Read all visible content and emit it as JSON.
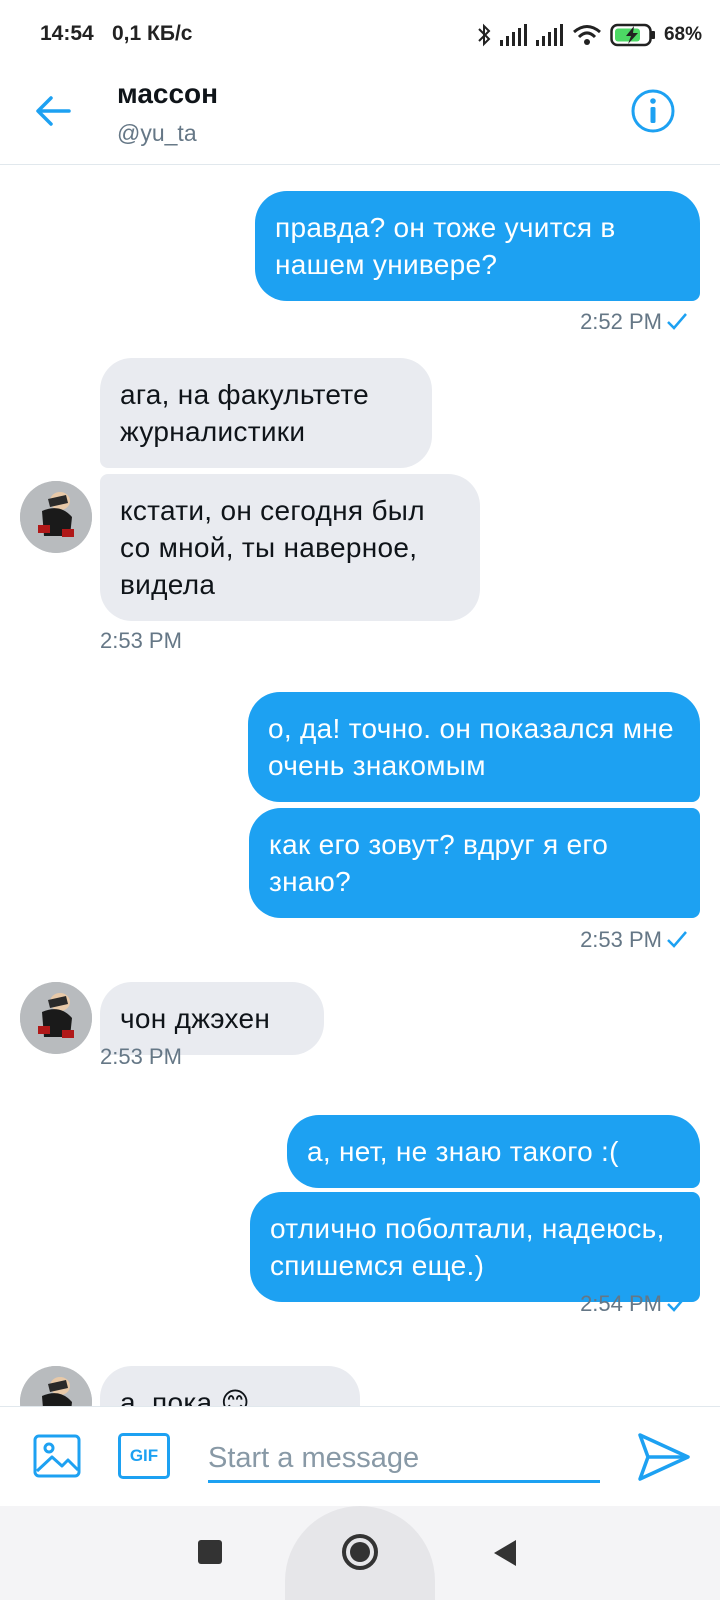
{
  "status_bar": {
    "time": "14:54",
    "network_speed": "0,1 КБ/с",
    "battery": "68%",
    "icons": [
      "bluetooth-icon",
      "signal-icon",
      "signal-icon",
      "wifi-icon",
      "battery-charging-icon"
    ]
  },
  "header": {
    "name": "массон",
    "handle": "@yu_ta",
    "icons": [
      "back-arrow-icon",
      "info-icon"
    ]
  },
  "messages": [
    {
      "direction": "out",
      "text": "правда? он тоже учится в нашем универе?"
    },
    {
      "direction": "out",
      "timestamp": "2:52 PM",
      "read": true
    },
    {
      "direction": "in",
      "text": "ага, на факультете журналистики"
    },
    {
      "direction": "in",
      "text": "кстати, он сегодня был со мной, ты наверное, видела"
    },
    {
      "direction": "in",
      "timestamp": "2:53 PM"
    },
    {
      "direction": "out",
      "text": "о, да! точно. он показался мне очень знакомым"
    },
    {
      "direction": "out",
      "text": "как его зовут? вдруг я его знаю?"
    },
    {
      "direction": "out",
      "timestamp": "2:53 PM",
      "read": true
    },
    {
      "direction": "in",
      "text": "чон джэхен"
    },
    {
      "direction": "in",
      "timestamp": "2:53 PM"
    },
    {
      "direction": "out",
      "text": "а, нет, не знаю такого :("
    },
    {
      "direction": "out",
      "text": "отлично поболтали, надеюсь, спишемся еще.)"
    },
    {
      "direction": "out",
      "timestamp": "2:54 PM",
      "read": true
    },
    {
      "direction": "in",
      "text": "а, пока 😊"
    }
  ],
  "composer": {
    "placeholder": "Start a message",
    "gif_label": "GIF",
    "icons": [
      "image-icon",
      "send-icon"
    ]
  },
  "colors": {
    "accent": "#1da1f2",
    "incoming_bubble": "#e9ebf0",
    "secondary_text": "#657786"
  }
}
